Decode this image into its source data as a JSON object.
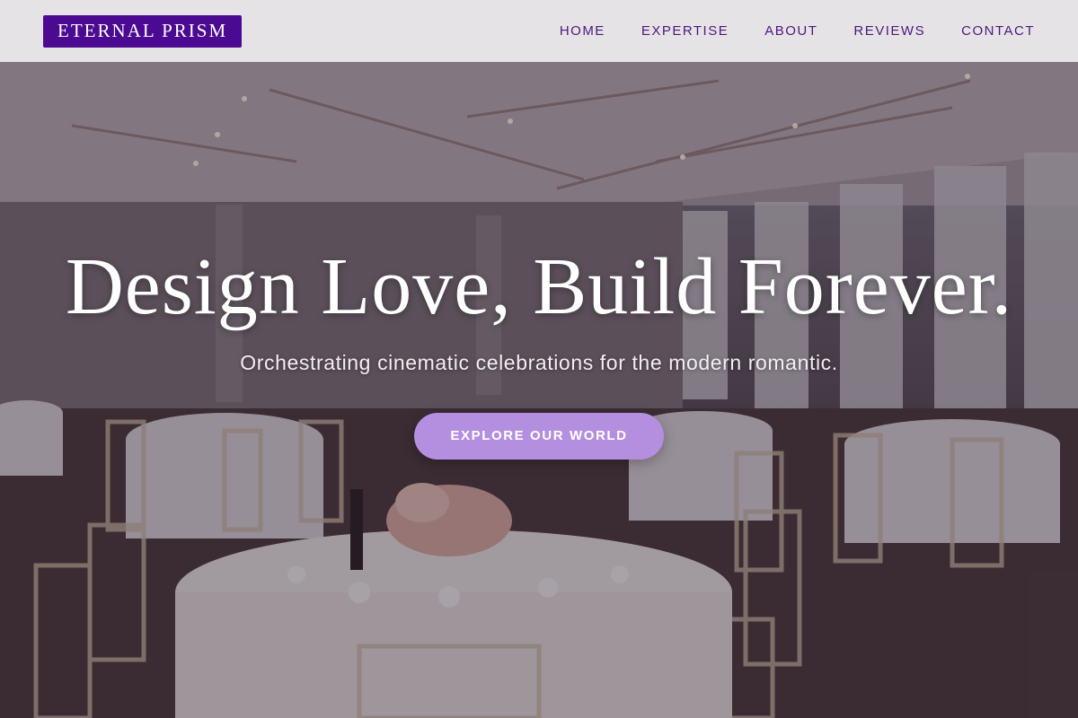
{
  "brand": {
    "name": "ETERNAL PRISM",
    "color": "#4b0a91"
  },
  "nav": {
    "items": [
      {
        "label": "HOME"
      },
      {
        "label": "EXPERTISE"
      },
      {
        "label": "ABOUT"
      },
      {
        "label": "REVIEWS"
      },
      {
        "label": "CONTACT"
      }
    ],
    "text_color": "#4b1880"
  },
  "hero": {
    "headline": "Design Love, Build Forever.",
    "subheadline": "Orchestrating cinematic celebrations for the modern romantic.",
    "cta_label": "EXPLORE OUR WORLD",
    "cta_color": "#b48fe0",
    "background_image": "wedding-reception-hall-photo"
  }
}
